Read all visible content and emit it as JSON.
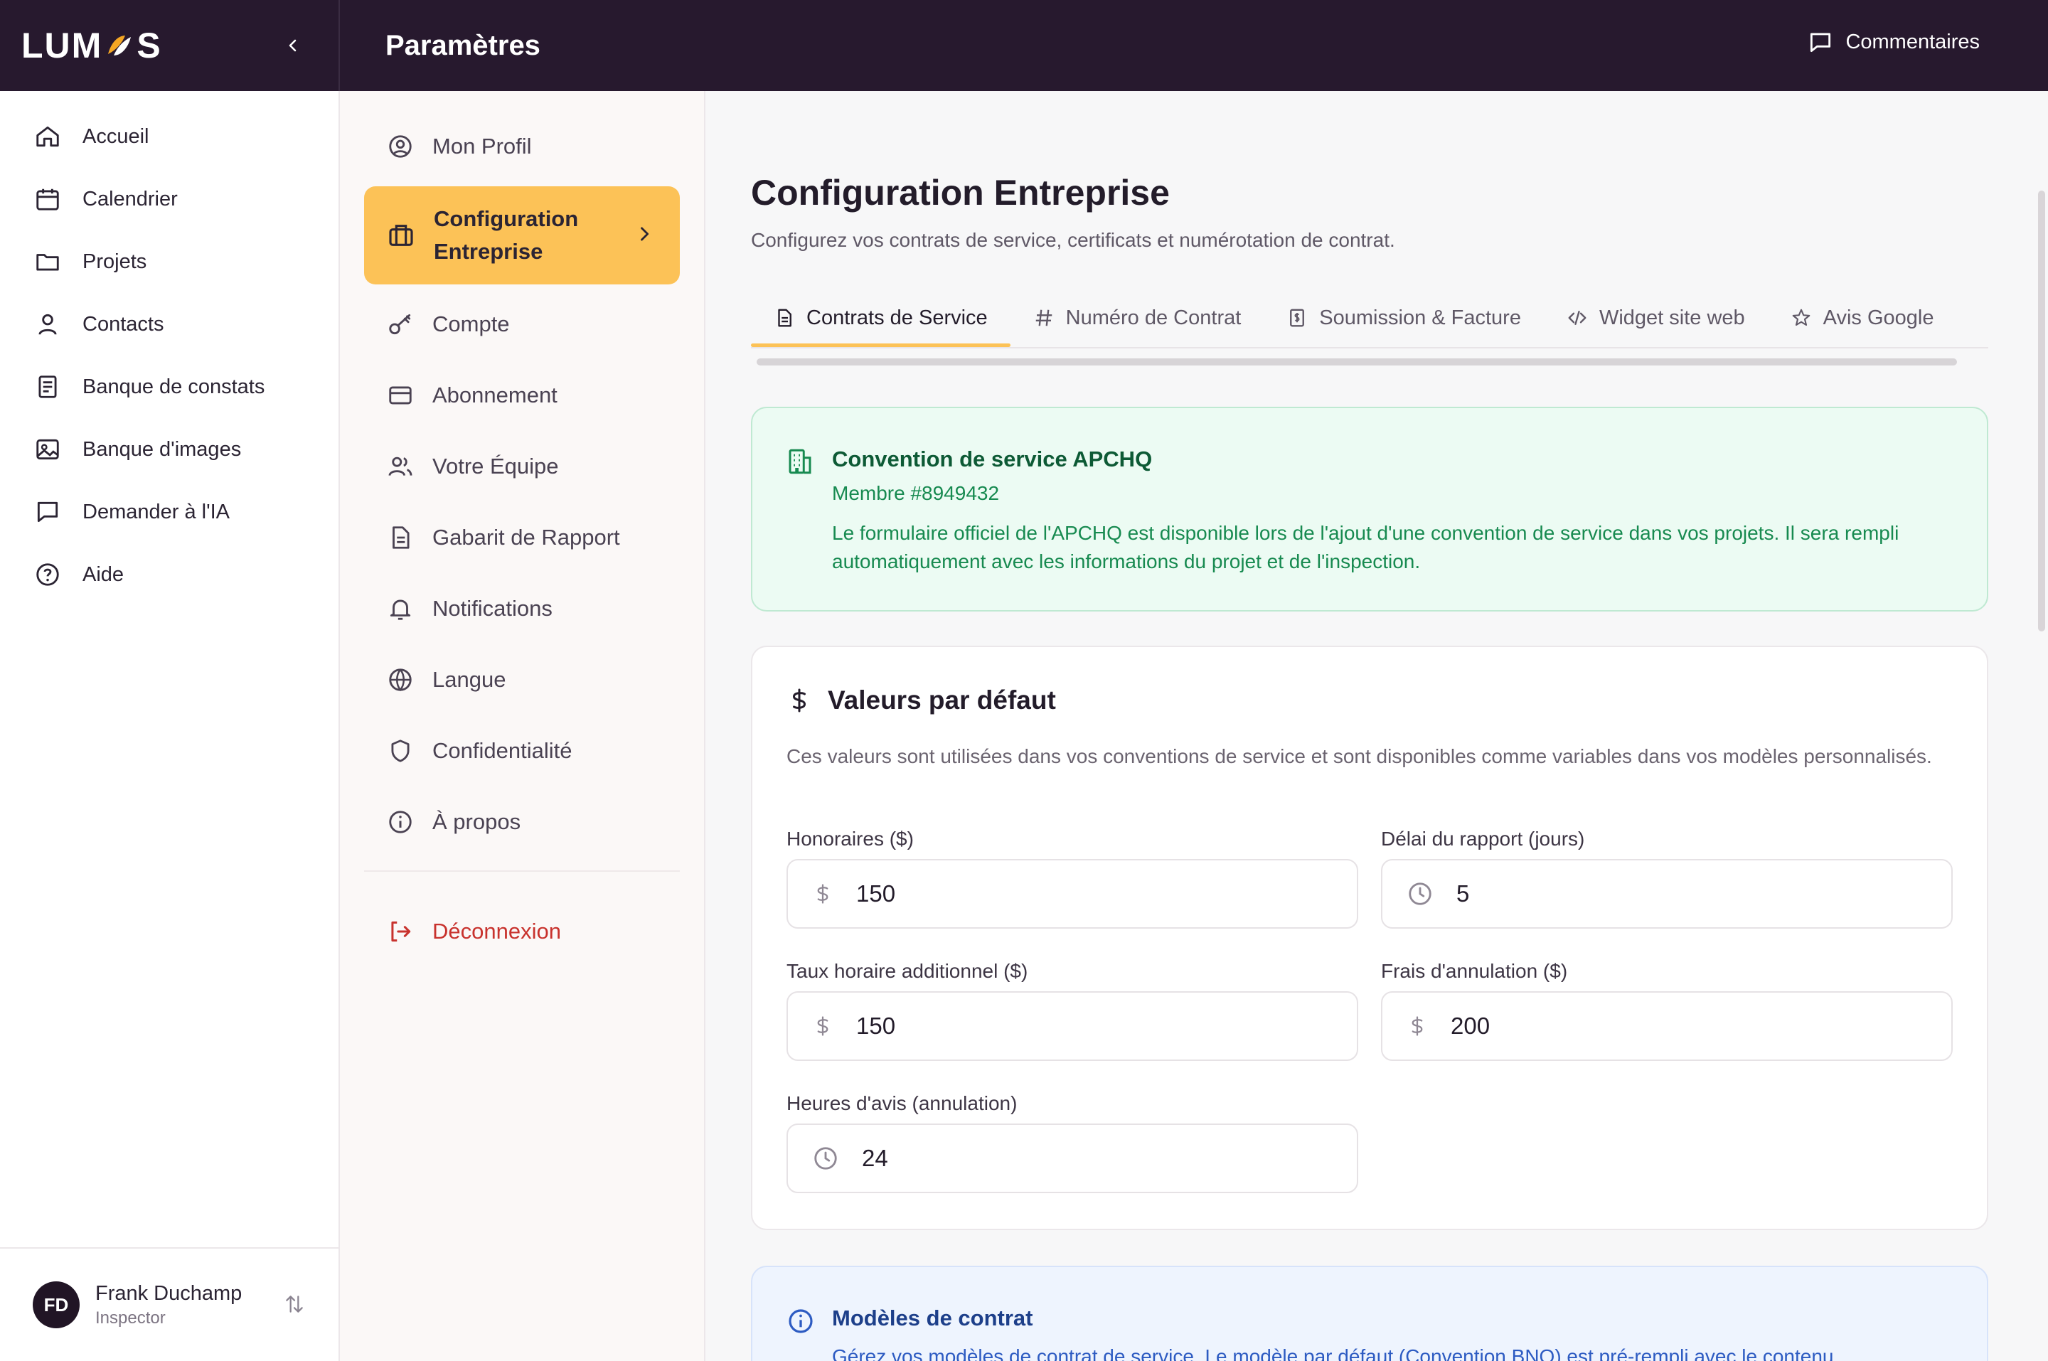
{
  "app": {
    "brand": "LUM",
    "brand_suffix": "S",
    "page_title": "Paramètres",
    "feedback_label": "Commentaires"
  },
  "sidebar": {
    "items": [
      {
        "label": "Accueil",
        "icon": "home-icon"
      },
      {
        "label": "Calendrier",
        "icon": "calendar-icon"
      },
      {
        "label": "Projets",
        "icon": "folder-icon"
      },
      {
        "label": "Contacts",
        "icon": "user-icon"
      },
      {
        "label": "Banque de constats",
        "icon": "document-list-icon"
      },
      {
        "label": "Banque d'images",
        "icon": "image-icon"
      },
      {
        "label": "Demander à l'IA",
        "icon": "chat-icon"
      },
      {
        "label": "Aide",
        "icon": "help-icon"
      }
    ],
    "user": {
      "initials": "FD",
      "name": "Frank Duchamp",
      "role": "Inspector"
    }
  },
  "settings_nav": {
    "items": [
      {
        "label": "Mon Profil",
        "icon": "profile-icon"
      },
      {
        "label": "Configuration Entreprise",
        "icon": "briefcase-icon",
        "active": true
      },
      {
        "label": "Compte",
        "icon": "key-icon"
      },
      {
        "label": "Abonnement",
        "icon": "credit-card-icon"
      },
      {
        "label": "Votre Équipe",
        "icon": "team-icon"
      },
      {
        "label": "Gabarit de Rapport",
        "icon": "report-icon"
      },
      {
        "label": "Notifications",
        "icon": "bell-icon"
      },
      {
        "label": "Langue",
        "icon": "globe-icon"
      },
      {
        "label": "Confidentialité",
        "icon": "shield-icon"
      },
      {
        "label": "À propos",
        "icon": "info-icon"
      }
    ],
    "logout_label": "Déconnexion"
  },
  "main": {
    "title": "Configuration Entreprise",
    "subtitle": "Configurez vos contrats de service, certificats et numérotation de contrat.",
    "tabs": [
      {
        "label": "Contrats de Service",
        "icon": "document-icon",
        "active": true
      },
      {
        "label": "Numéro de Contrat",
        "icon": "hash-icon"
      },
      {
        "label": "Soumission & Facture",
        "icon": "invoice-icon"
      },
      {
        "label": "Widget site web",
        "icon": "code-icon"
      },
      {
        "label": "Avis Google",
        "icon": "star-icon"
      }
    ],
    "apchq": {
      "title": "Convention de service APCHQ",
      "member": "Membre #8949432",
      "text": "Le formulaire officiel de l'APCHQ est disponible lors de l'ajout d'une convention de service dans vos projets. Il sera rempli automatiquement avec les informations du projet et de l'inspection."
    },
    "defaults": {
      "title": "Valeurs par défaut",
      "description": "Ces valeurs sont utilisées dans vos conventions de service et sont disponibles comme variables dans vos modèles personnalisés.",
      "fields": {
        "fee": {
          "label": "Honoraires ($)",
          "value": "150"
        },
        "report_delay": {
          "label": "Délai du rapport (jours)",
          "value": "5"
        },
        "hourly_rate": {
          "label": "Taux horaire additionnel ($)",
          "value": "150"
        },
        "cancel_fee": {
          "label": "Frais d'annulation ($)",
          "value": "200"
        },
        "notice_hours": {
          "label": "Heures d'avis (annulation)",
          "value": "24"
        }
      }
    },
    "models": {
      "title": "Modèles de contrat",
      "text": "Gérez vos modèles de contrat de service. Le modèle par défaut (Convention BNQ) est pré-rempli avec le contenu"
    }
  },
  "colors": {
    "topbar": "#27192e",
    "accent": "#fcc257",
    "logout": "#c8322d",
    "success_bg": "#ecfbf3",
    "success_text": "#178a50",
    "info_bg": "#eef4fe"
  }
}
